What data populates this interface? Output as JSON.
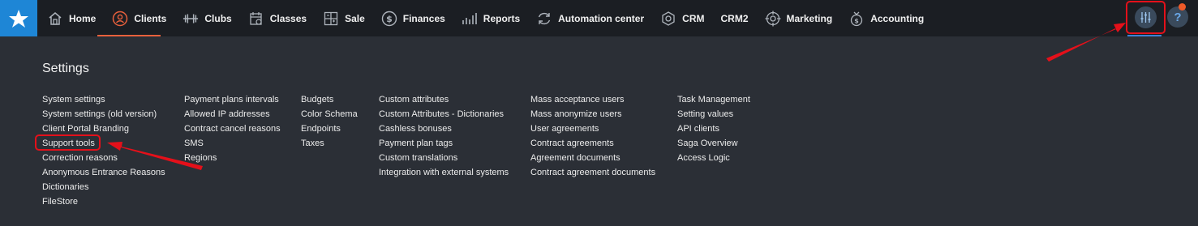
{
  "nav": {
    "items": [
      {
        "label": "Home",
        "icon": "home-icon"
      },
      {
        "label": "Clients",
        "icon": "clients-icon",
        "active": true
      },
      {
        "label": "Clubs",
        "icon": "dumbbell-icon"
      },
      {
        "label": "Classes",
        "icon": "calendar-icon"
      },
      {
        "label": "Sale",
        "icon": "grid-icon"
      },
      {
        "label": "Finances",
        "icon": "dollar-icon"
      },
      {
        "label": "Reports",
        "icon": "bar-chart-icon"
      },
      {
        "label": "Automation center",
        "icon": "refresh-icon"
      },
      {
        "label": "CRM",
        "icon": "crm-icon"
      },
      {
        "label": "CRM2",
        "icon": ""
      },
      {
        "label": "Marketing",
        "icon": "target-icon"
      },
      {
        "label": "Accounting",
        "icon": "accounting-icon"
      }
    ],
    "help_label": "?"
  },
  "colors": {
    "accent_active": "#e8603c",
    "logo_bg": "#1e86d6",
    "annotation": "#e4101a"
  },
  "settings": {
    "title": "Settings",
    "columns": [
      [
        "System settings",
        "System settings (old version)",
        "Client Portal Branding",
        "Support tools",
        "Correction reasons",
        "Anonymous Entrance Reasons",
        "Dictionaries",
        "FileStore"
      ],
      [
        "Payment plans intervals",
        "Allowed IP addresses",
        "Contract cancel reasons",
        "SMS",
        "Regions"
      ],
      [
        "Budgets",
        "Color Schema",
        "Endpoints",
        "Taxes"
      ],
      [
        "Custom attributes",
        "Custom Attributes - Dictionaries",
        "Cashless bonuses",
        "Payment plan tags",
        "Custom translations",
        "Integration with external systems"
      ],
      [
        "Mass acceptance users",
        "Mass anonymize users",
        "User agreements",
        "Contract agreements",
        "Agreement documents",
        "Contract agreement documents"
      ],
      [
        "Task Management",
        "Setting values",
        "API clients",
        "Saga Overview",
        "Access Logic"
      ]
    ]
  }
}
